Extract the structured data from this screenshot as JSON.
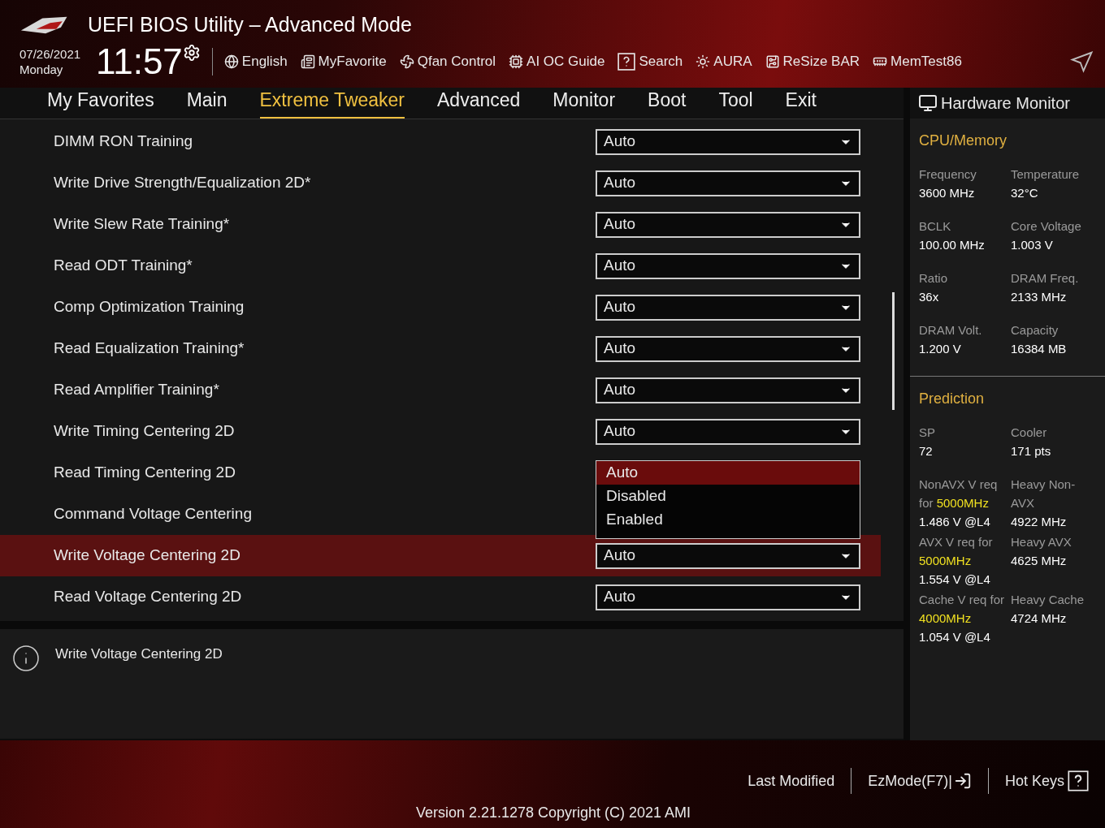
{
  "header": {
    "title": "UEFI BIOS Utility – Advanced Mode",
    "date": "07/26/2021",
    "day": "Monday",
    "time": "11:57",
    "tools": [
      {
        "kind": "globe",
        "label": "English"
      },
      {
        "kind": "favorite",
        "label": "MyFavorite"
      },
      {
        "kind": "fan",
        "label": "Qfan Control"
      },
      {
        "kind": "aioc",
        "label": "AI OC Guide"
      },
      {
        "kind": "search",
        "label": "Search"
      },
      {
        "kind": "aura",
        "label": "AURA"
      },
      {
        "kind": "resize",
        "label": "ReSize BAR"
      },
      {
        "kind": "memtest",
        "label": "MemTest86"
      }
    ]
  },
  "tabs": [
    {
      "label": "My Favorites",
      "selected": false
    },
    {
      "label": "Main",
      "selected": false
    },
    {
      "label": "Extreme Tweaker",
      "selected": true
    },
    {
      "label": "Advanced",
      "selected": false
    },
    {
      "label": "Monitor",
      "selected": false
    },
    {
      "label": "Boot",
      "selected": false
    },
    {
      "label": "Tool",
      "selected": false
    },
    {
      "label": "Exit",
      "selected": false
    }
  ],
  "settings": [
    {
      "label": "DIMM RON Training",
      "value": "Auto",
      "selected": false
    },
    {
      "label": "Write Drive Strength/Equalization 2D*",
      "value": "Auto",
      "selected": false
    },
    {
      "label": "Write Slew Rate Training*",
      "value": "Auto",
      "selected": false
    },
    {
      "label": "Read ODT Training*",
      "value": "Auto",
      "selected": false
    },
    {
      "label": "Comp Optimization Training",
      "value": "Auto",
      "selected": false
    },
    {
      "label": "Read Equalization Training*",
      "value": "Auto",
      "selected": false
    },
    {
      "label": "Read Amplifier Training*",
      "value": "Auto",
      "selected": false
    },
    {
      "label": "Write Timing Centering 2D",
      "value": "Auto",
      "selected": false
    },
    {
      "label": "Read Timing Centering 2D",
      "selected": false
    },
    {
      "label": "Command Voltage Centering",
      "selected": false
    },
    {
      "label": "Write Voltage Centering 2D",
      "value": "Auto",
      "selected": true
    },
    {
      "label": "Read Voltage Centering 2D",
      "value": "Auto",
      "selected": false
    }
  ],
  "dropdown": {
    "options": [
      {
        "label": "Auto",
        "selected": true
      },
      {
        "label": "Disabled",
        "selected": false
      },
      {
        "label": "Enabled",
        "selected": false
      }
    ]
  },
  "help": {
    "text": "Write Voltage Centering 2D"
  },
  "hardware_monitor": {
    "title": "Hardware Monitor",
    "sections": [
      {
        "title": "CPU/Memory",
        "items": [
          {
            "label": "Frequency",
            "value": "3600 MHz"
          },
          {
            "label": "Temperature",
            "value": "32°C"
          },
          {
            "label": "BCLK",
            "value": "100.00 MHz"
          },
          {
            "label": "Core Voltage",
            "value": "1.003 V"
          },
          {
            "label": "Ratio",
            "value": "36x"
          },
          {
            "label": "DRAM Freq.",
            "value": "2133 MHz"
          },
          {
            "label": "DRAM Volt.",
            "value": "1.200 V"
          },
          {
            "label": "Capacity",
            "value": "16384 MB"
          }
        ]
      },
      {
        "title": "Prediction",
        "items": [
          {
            "label": "SP",
            "value": "72"
          },
          {
            "label": "Cooler",
            "value": "171 pts"
          },
          {
            "label": "NonAVX V req for",
            "highlight": "5000MHz",
            "value": "1.486 V @L4"
          },
          {
            "label": "Heavy Non-AVX",
            "value": "4922 MHz"
          },
          {
            "label": "AVX V req for",
            "highlight": "5000MHz",
            "value": "1.554 V @L4"
          },
          {
            "label": "Heavy AVX",
            "value": "4625 MHz"
          },
          {
            "label": "Cache V req for",
            "highlight": "4000MHz",
            "value": "1.054 V @L4"
          },
          {
            "label": "Heavy Cache",
            "value": "4724 MHz"
          }
        ]
      }
    ]
  },
  "footer": {
    "last_modified": "Last Modified",
    "ezmode": "EzMode(F7)|",
    "hot_keys": "Hot Keys",
    "version": "Version 2.21.1278 Copyright (C) 2021 AMI"
  }
}
